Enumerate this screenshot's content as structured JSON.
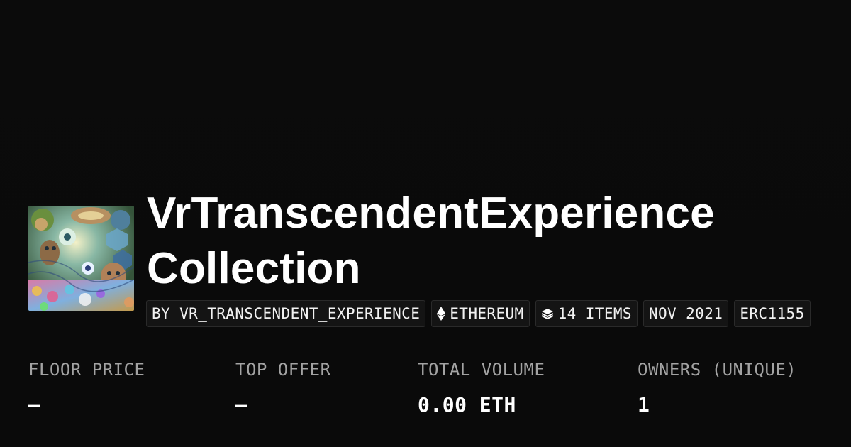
{
  "collection": {
    "title_lines": [
      "VrTranscendentExperience",
      "Collection"
    ],
    "avatar_icon": "psychedelic-artwork-thumbnail"
  },
  "chips": {
    "creator": "BY VR_TRANSCENDENT_EXPERIENCE",
    "chain": "ETHEREUM",
    "chain_icon": "ethereum-icon",
    "items": "14 ITEMS",
    "items_icon": "layers-icon",
    "date": "NOV 2021",
    "standard": "ERC1155"
  },
  "stats": [
    {
      "label": "FLOOR PRICE",
      "value": "—"
    },
    {
      "label": "TOP OFFER",
      "value": "—"
    },
    {
      "label": "TOTAL VOLUME",
      "value": "0.00 ETH"
    },
    {
      "label": "OWNERS (UNIQUE)",
      "value": "1"
    }
  ],
  "colors": {
    "background": "#0a0a0a",
    "text": "#ffffff",
    "muted": "#a3a3a3",
    "chip_bg": "#141414",
    "chip_border": "#2a2a2a"
  }
}
